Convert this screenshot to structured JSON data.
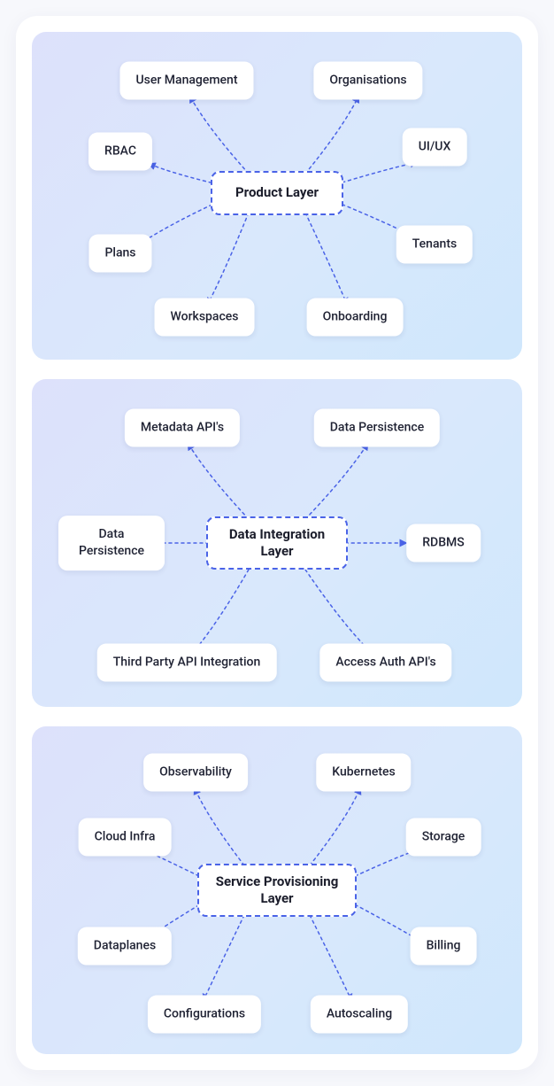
{
  "panels": [
    {
      "hub": "Product Layer",
      "nodes": {
        "n1": "User Management",
        "n2": "Organisations",
        "n3": "RBAC",
        "n4": "UI/UX",
        "n5": "Plans",
        "n6": "Tenants",
        "n7": "Workspaces",
        "n8": "Onboarding"
      }
    },
    {
      "hub": "Data Integration Layer",
      "nodes": {
        "n1": "Metadata API's",
        "n2": "Data Persistence",
        "n3": "Data\nPersistence",
        "n4": "RDBMS",
        "n5": "Third Party API Integration",
        "n6": "Access Auth API's"
      }
    },
    {
      "hub": "Service Provisioning Layer",
      "nodes": {
        "n1": "Observability",
        "n2": "Kubernetes",
        "n3": "Cloud Infra",
        "n4": "Storage",
        "n5": "Dataplanes",
        "n6": "Billing",
        "n7": "Configurations",
        "n8": "Autoscaling"
      }
    }
  ],
  "colors": {
    "accent": "#4a63e7",
    "panel_start": "#dde1fb",
    "panel_end": "#cfe7fc"
  }
}
